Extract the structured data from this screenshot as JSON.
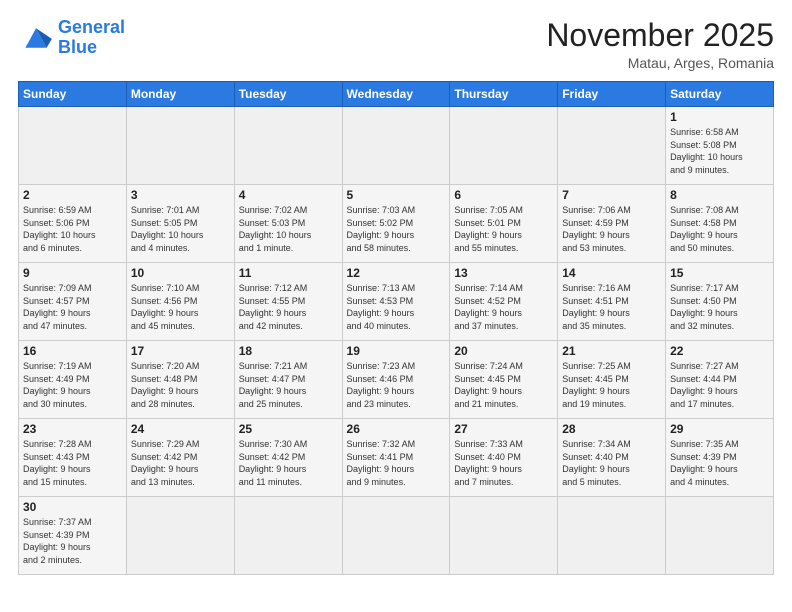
{
  "logo": {
    "line1": "General",
    "line2": "Blue"
  },
  "title": "November 2025",
  "location": "Matau, Arges, Romania",
  "days_header": [
    "Sunday",
    "Monday",
    "Tuesday",
    "Wednesday",
    "Thursday",
    "Friday",
    "Saturday"
  ],
  "weeks": [
    [
      {
        "day": "",
        "info": ""
      },
      {
        "day": "",
        "info": ""
      },
      {
        "day": "",
        "info": ""
      },
      {
        "day": "",
        "info": ""
      },
      {
        "day": "",
        "info": ""
      },
      {
        "day": "",
        "info": ""
      },
      {
        "day": "1",
        "info": "Sunrise: 6:58 AM\nSunset: 5:08 PM\nDaylight: 10 hours\nand 9 minutes."
      }
    ],
    [
      {
        "day": "2",
        "info": "Sunrise: 6:59 AM\nSunset: 5:06 PM\nDaylight: 10 hours\nand 6 minutes."
      },
      {
        "day": "3",
        "info": "Sunrise: 7:01 AM\nSunset: 5:05 PM\nDaylight: 10 hours\nand 4 minutes."
      },
      {
        "day": "4",
        "info": "Sunrise: 7:02 AM\nSunset: 5:03 PM\nDaylight: 10 hours\nand 1 minute."
      },
      {
        "day": "5",
        "info": "Sunrise: 7:03 AM\nSunset: 5:02 PM\nDaylight: 9 hours\nand 58 minutes."
      },
      {
        "day": "6",
        "info": "Sunrise: 7:05 AM\nSunset: 5:01 PM\nDaylight: 9 hours\nand 55 minutes."
      },
      {
        "day": "7",
        "info": "Sunrise: 7:06 AM\nSunset: 4:59 PM\nDaylight: 9 hours\nand 53 minutes."
      },
      {
        "day": "8",
        "info": "Sunrise: 7:08 AM\nSunset: 4:58 PM\nDaylight: 9 hours\nand 50 minutes."
      }
    ],
    [
      {
        "day": "9",
        "info": "Sunrise: 7:09 AM\nSunset: 4:57 PM\nDaylight: 9 hours\nand 47 minutes."
      },
      {
        "day": "10",
        "info": "Sunrise: 7:10 AM\nSunset: 4:56 PM\nDaylight: 9 hours\nand 45 minutes."
      },
      {
        "day": "11",
        "info": "Sunrise: 7:12 AM\nSunset: 4:55 PM\nDaylight: 9 hours\nand 42 minutes."
      },
      {
        "day": "12",
        "info": "Sunrise: 7:13 AM\nSunset: 4:53 PM\nDaylight: 9 hours\nand 40 minutes."
      },
      {
        "day": "13",
        "info": "Sunrise: 7:14 AM\nSunset: 4:52 PM\nDaylight: 9 hours\nand 37 minutes."
      },
      {
        "day": "14",
        "info": "Sunrise: 7:16 AM\nSunset: 4:51 PM\nDaylight: 9 hours\nand 35 minutes."
      },
      {
        "day": "15",
        "info": "Sunrise: 7:17 AM\nSunset: 4:50 PM\nDaylight: 9 hours\nand 32 minutes."
      }
    ],
    [
      {
        "day": "16",
        "info": "Sunrise: 7:19 AM\nSunset: 4:49 PM\nDaylight: 9 hours\nand 30 minutes."
      },
      {
        "day": "17",
        "info": "Sunrise: 7:20 AM\nSunset: 4:48 PM\nDaylight: 9 hours\nand 28 minutes."
      },
      {
        "day": "18",
        "info": "Sunrise: 7:21 AM\nSunset: 4:47 PM\nDaylight: 9 hours\nand 25 minutes."
      },
      {
        "day": "19",
        "info": "Sunrise: 7:23 AM\nSunset: 4:46 PM\nDaylight: 9 hours\nand 23 minutes."
      },
      {
        "day": "20",
        "info": "Sunrise: 7:24 AM\nSunset: 4:45 PM\nDaylight: 9 hours\nand 21 minutes."
      },
      {
        "day": "21",
        "info": "Sunrise: 7:25 AM\nSunset: 4:45 PM\nDaylight: 9 hours\nand 19 minutes."
      },
      {
        "day": "22",
        "info": "Sunrise: 7:27 AM\nSunset: 4:44 PM\nDaylight: 9 hours\nand 17 minutes."
      }
    ],
    [
      {
        "day": "23",
        "info": "Sunrise: 7:28 AM\nSunset: 4:43 PM\nDaylight: 9 hours\nand 15 minutes."
      },
      {
        "day": "24",
        "info": "Sunrise: 7:29 AM\nSunset: 4:42 PM\nDaylight: 9 hours\nand 13 minutes."
      },
      {
        "day": "25",
        "info": "Sunrise: 7:30 AM\nSunset: 4:42 PM\nDaylight: 9 hours\nand 11 minutes."
      },
      {
        "day": "26",
        "info": "Sunrise: 7:32 AM\nSunset: 4:41 PM\nDaylight: 9 hours\nand 9 minutes."
      },
      {
        "day": "27",
        "info": "Sunrise: 7:33 AM\nSunset: 4:40 PM\nDaylight: 9 hours\nand 7 minutes."
      },
      {
        "day": "28",
        "info": "Sunrise: 7:34 AM\nSunset: 4:40 PM\nDaylight: 9 hours\nand 5 minutes."
      },
      {
        "day": "29",
        "info": "Sunrise: 7:35 AM\nSunset: 4:39 PM\nDaylight: 9 hours\nand 4 minutes."
      }
    ],
    [
      {
        "day": "30",
        "info": "Sunrise: 7:37 AM\nSunset: 4:39 PM\nDaylight: 9 hours\nand 2 minutes."
      },
      {
        "day": "",
        "info": ""
      },
      {
        "day": "",
        "info": ""
      },
      {
        "day": "",
        "info": ""
      },
      {
        "day": "",
        "info": ""
      },
      {
        "day": "",
        "info": ""
      },
      {
        "day": "",
        "info": ""
      }
    ]
  ]
}
